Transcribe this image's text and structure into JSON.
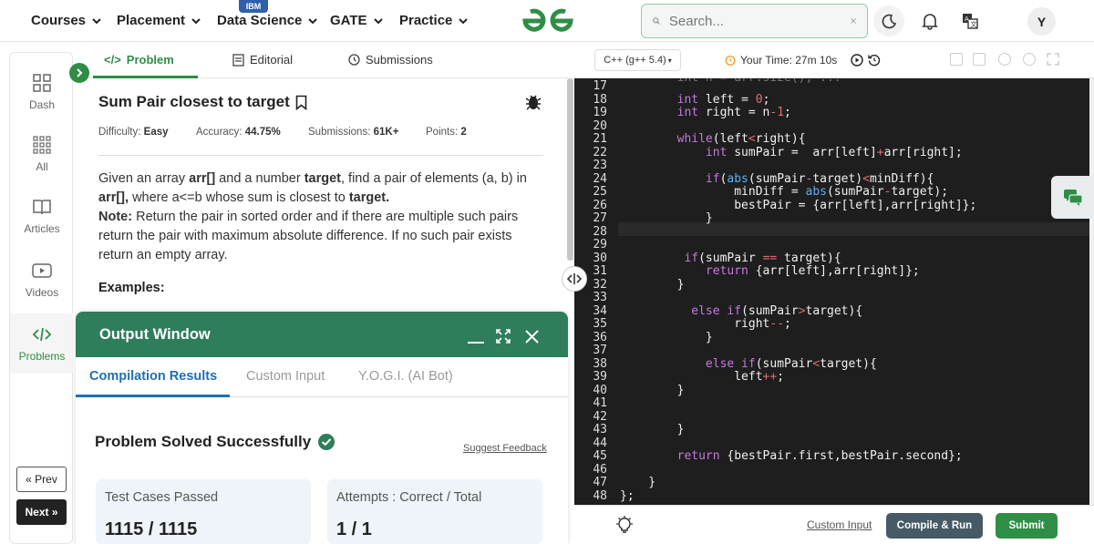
{
  "nav": {
    "items": [
      {
        "label": "Courses"
      },
      {
        "label": "Placement"
      },
      {
        "label": "Data Science"
      },
      {
        "label": "GATE"
      },
      {
        "label": "Practice"
      }
    ],
    "ibm_badge": "IBM",
    "search_placeholder": "Search...",
    "avatar_letter": "Y"
  },
  "sidebar": {
    "items": [
      {
        "label": "Dash",
        "icon": "dashboard-icon"
      },
      {
        "label": "All",
        "icon": "grid-icon"
      },
      {
        "label": "Articles",
        "icon": "book-icon"
      },
      {
        "label": "Videos",
        "icon": "video-icon"
      },
      {
        "label": "Problems",
        "icon": "code-icon"
      }
    ],
    "prev": "« Prev",
    "next": "Next »"
  },
  "problem_tabs": {
    "problem": "Problem",
    "editorial": "Editorial",
    "submissions": "Submissions"
  },
  "problem": {
    "title": "Sum Pair closest to target",
    "difficulty_label": "Difficulty:",
    "difficulty": "Easy",
    "accuracy_label": "Accuracy:",
    "accuracy": "44.75%",
    "submissions_label": "Submissions:",
    "submissions": "61K+",
    "points_label": "Points:",
    "points": "2",
    "examples": "Examples:"
  },
  "output_window": {
    "title": "Output Window",
    "tabs": [
      "Compilation Results",
      "Custom Input",
      "Y.O.G.I. (AI Bot)"
    ],
    "status": "Problem Solved Successfully",
    "feedback": "Suggest Feedback",
    "tests_label": "Test Cases Passed",
    "tests_value": "1115 / 1115",
    "attempts_label": "Attempts : Correct / Total",
    "attempts_value": "1 / 1"
  },
  "editor": {
    "language": "C++ (g++ 5.4)",
    "timer": "Your Time: 27m 10s",
    "custom_input": "Custom Input",
    "compile_run": "Compile & Run",
    "submit": "Submit"
  },
  "colors": {
    "brand_green": "#2f8d46",
    "output_header": "#2e7d5b",
    "active_tab_blue": "#1f6fb0",
    "editor_bg": "#1e1e1e",
    "compile_btn": "#455a64"
  }
}
